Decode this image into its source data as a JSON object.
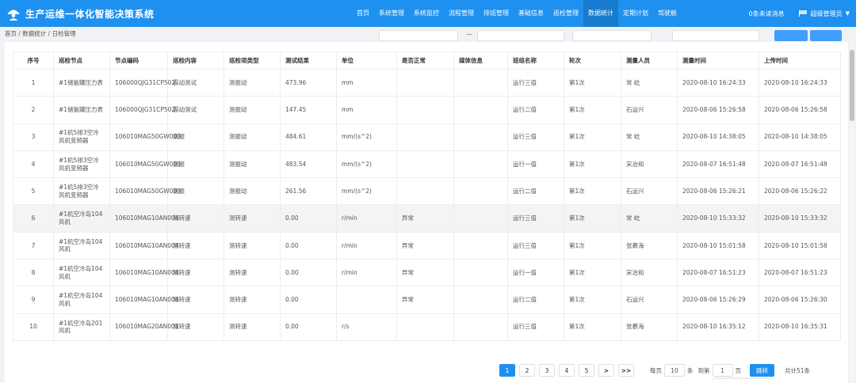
{
  "app": {
    "title": "生产运维一体化智能决策系统",
    "brand_color": "#1e90f0",
    "accent_color": "#409eff"
  },
  "nav": {
    "items": [
      {
        "label": "首页"
      },
      {
        "label": "系统管理"
      },
      {
        "label": "系统监控"
      },
      {
        "label": "流程管理"
      },
      {
        "label": "排班管理"
      },
      {
        "label": "基础信息"
      },
      {
        "label": "巡检管理"
      },
      {
        "label": "数据统计",
        "active": true
      },
      {
        "label": "定期计划"
      },
      {
        "label": "驾驶舱"
      }
    ]
  },
  "header": {
    "notice": "0条未读消息",
    "user": "超级管理员"
  },
  "breadcrumb": "首页 / 数据统计 / 日检管理",
  "table": {
    "columns": [
      "序号",
      "巡检节点",
      "节点编码",
      "巡检内容",
      "巡检项类型",
      "测试结果",
      "单位",
      "是否正常",
      "媒体信息",
      "班组名称",
      "轮次",
      "测量人员",
      "测量时间",
      "上传时间"
    ],
    "rows": [
      [
        "1",
        "#1储氨罐压力表",
        "106000QJG31CP502",
        "震动测试",
        "测振动",
        "473.96",
        "mm",
        "",
        "",
        "运行三值",
        "第1次",
        "常 屹",
        "2020-08-10 16:24:33",
        "2020-08-10 16:24:33"
      ],
      [
        "2",
        "#1储氨罐压力表",
        "106000QJG31CP502",
        "震动测试",
        "测振动",
        "147.45",
        "mm",
        "",
        "",
        "运行二值",
        "第1次",
        "石运兴",
        "2020-08-06 15:26:58",
        "2020-08-06 15:26:58"
      ],
      [
        "3",
        "#1机5排3空冷风机变频器",
        "106010MAG50GW003",
        "测振",
        "测振动",
        "484.61",
        "mm/(s^2)",
        "",
        "",
        "运行三值",
        "第1次",
        "常 屹",
        "2020-08-10 14:38:05",
        "2020-08-10 14:38:05"
      ],
      [
        "4",
        "#1机5排3空冷风机变频器",
        "106010MAG50GW003",
        "测振",
        "测振动",
        "483.54",
        "mm/(s^2)",
        "",
        "",
        "运行一值",
        "第1次",
        "宋治和",
        "2020-08-07 16:51:48",
        "2020-08-07 16:51:48"
      ],
      [
        "5",
        "#1机5排3空冷风机变频器",
        "106010MAG50GW003",
        "测振",
        "测振动",
        "261.56",
        "mm/(s^2)",
        "",
        "",
        "运行二值",
        "第1次",
        "石运兴",
        "2020-08-06 15:26:21",
        "2020-08-06 15:26:22"
      ],
      [
        "6",
        "#1机空冷岛104风机",
        "106010MAG10AN004",
        "测转速",
        "测转速",
        "0.00",
        "r/min",
        "异常",
        "",
        "运行三值",
        "第1次",
        "常 屹",
        "2020-08-10 15:33:32",
        "2020-08-10 15:33:32"
      ],
      [
        "7",
        "#1机空冷岛104风机",
        "106010MAG10AN004",
        "测转速",
        "测转速",
        "0.00",
        "r/min",
        "异常",
        "",
        "运行三值",
        "第1次",
        "张慕海",
        "2020-08-10 15:01:58",
        "2020-08-10 15:01:58"
      ],
      [
        "8",
        "#1机空冷岛104风机",
        "106010MAG10AN004",
        "测转速",
        "测转速",
        "0.00",
        "r/min",
        "异常",
        "",
        "运行一值",
        "第1次",
        "宋治和",
        "2020-08-07 16:51:23",
        "2020-08-07 16:51:23"
      ],
      [
        "9",
        "#1机空冷岛104风机",
        "106010MAG10AN004",
        "测转速",
        "测转速",
        "0.00",
        "",
        "异常",
        "",
        "运行二值",
        "第1次",
        "石运兴",
        "2020-08-06 15:26:29",
        "2020-08-06 15:26:30"
      ],
      [
        "10",
        "#1机空冷岛201风机",
        "106010MAG20AN001",
        "测转速",
        "测转速",
        "0.00",
        "r/s",
        "",
        "",
        "运行三值",
        "第1次",
        "张慕海",
        "2020-08-10 16:35:12",
        "2020-08-10 16:35:31"
      ]
    ],
    "highlighted_row": 5
  },
  "pagination": {
    "pages": [
      "1",
      "2",
      "3",
      "4",
      "5"
    ],
    "current": "1",
    "next": ">",
    "last": ">>",
    "per_page_label": "每页",
    "per_page": "10",
    "per_page_unit": "条",
    "goto_label": "到第",
    "goto_value": "1",
    "goto_unit": "页",
    "goto_button": "跳转",
    "total": "共计51条"
  }
}
